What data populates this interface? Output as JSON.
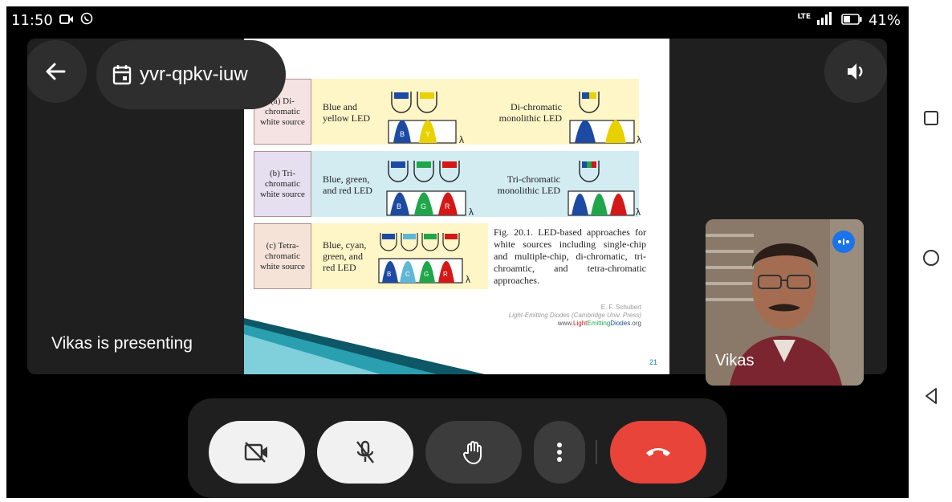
{
  "status_bar": {
    "time": "11:50",
    "network": "LTE",
    "battery": "41%"
  },
  "meeting": {
    "code": "yvr-qpkv-iuw",
    "presenting_text": "Vikas is presenting",
    "self_name": "Vikas"
  },
  "slide": {
    "rows": [
      {
        "label": "(a) Di-chromatic white source",
        "left_text": "Blue and yellow LED",
        "right_text": "Di-chromatic monolithic LED",
        "bg": "#fff6c8",
        "peaks_left": [
          "B",
          "Y"
        ],
        "peak_colors_left": [
          "#1d4ba3",
          "#e9d100"
        ],
        "peak_colors_right": [
          "#1d4ba3",
          "#e9d100"
        ]
      },
      {
        "label": "(b) Tri-chromatic white source",
        "left_text": "Blue, green, and red LED",
        "right_text": "Tri-chromatic monolithic LED",
        "bg": "#d2ecf2",
        "peaks_left": [
          "B",
          "G",
          "R"
        ],
        "peak_colors_left": [
          "#1d4ba3",
          "#20a64a",
          "#d41818"
        ],
        "peak_colors_right": [
          "#1d4ba3",
          "#20a64a",
          "#d41818"
        ]
      },
      {
        "label": "(c) Tetra-chromatic white source",
        "left_text": "Blue, cyan, green, and red LED",
        "right_text": "",
        "bg": "#fff6c8",
        "peaks_left": [
          "B",
          "C",
          "G",
          "R"
        ],
        "peak_colors_left": [
          "#1d4ba3",
          "#5fb7d6",
          "#20a64a",
          "#d41818"
        ],
        "peak_colors_right": []
      }
    ],
    "lambda": "λ",
    "caption": "Fig. 20.1. LED-based approaches for white sources including single-chip and multiple-chip, di-chromatic, tri-chroamtic, and tetra-chromatic approaches.",
    "credit_author": "E. F. Schubert",
    "credit_book": "Light-Emitting Diodes (Cambridge Univ. Press)",
    "credit_url_prefix": "www.",
    "credit_url_a": "Light",
    "credit_url_b": "Emitting",
    "credit_url_c": "Diodes",
    "credit_url_suffix": ".org",
    "page_number": "21"
  },
  "colors": {
    "end_call": "#e8443a",
    "control_light": "#f1f1f1",
    "control_dark": "#3c3c3c",
    "accent_blue": "#1a73e8"
  },
  "icons": {
    "back": "arrow-left-icon",
    "calendar": "calendar-icon",
    "speaker": "speaker-icon",
    "camera_off": "camera-off-icon",
    "mic_off": "mic-off-icon",
    "raise_hand": "hand-icon",
    "more": "more-vert-icon",
    "end_call": "phone-hangup-icon"
  }
}
